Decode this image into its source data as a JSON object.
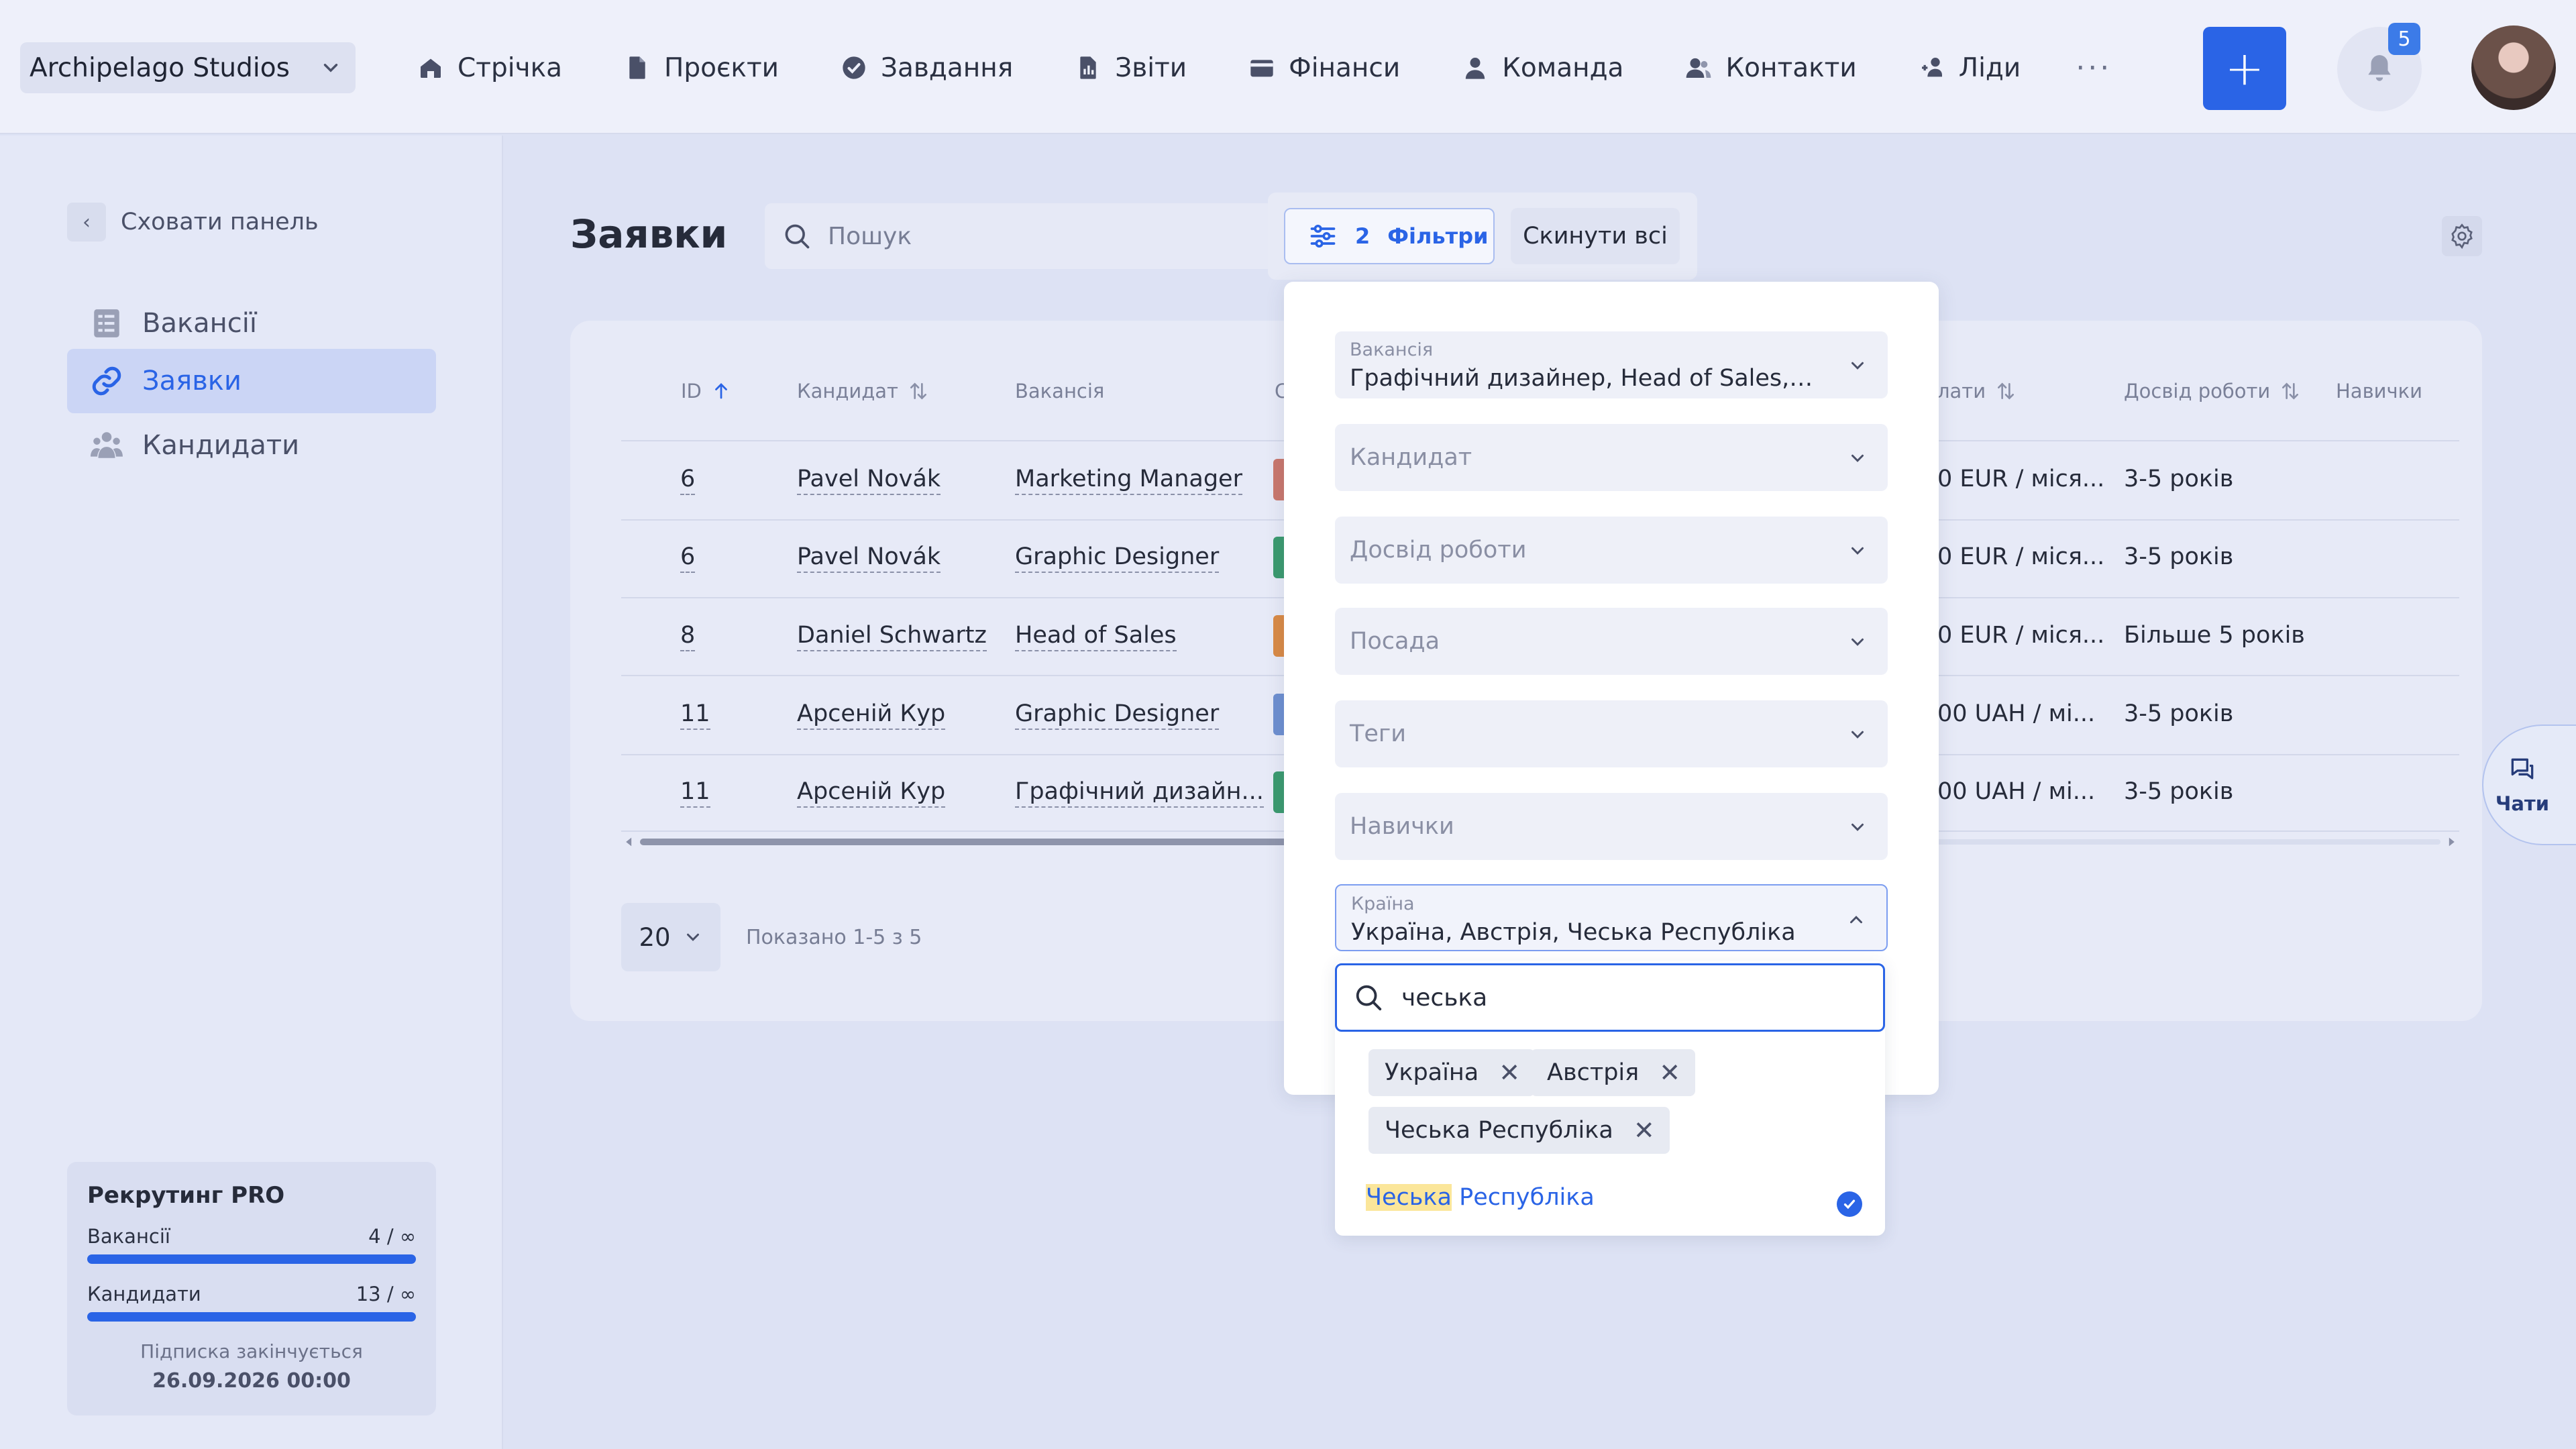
{
  "workspace": {
    "name": "Archipelago Studios"
  },
  "nav": [
    {
      "label": "Стрічка",
      "icon": "home-icon"
    },
    {
      "label": "Проєкти",
      "icon": "document-icon"
    },
    {
      "label": "Завдання",
      "icon": "check-circle-icon"
    },
    {
      "label": "Звіти",
      "icon": "report-icon"
    },
    {
      "label": "Фінанси",
      "icon": "wallet-icon"
    },
    {
      "label": "Команда",
      "icon": "person-icon"
    },
    {
      "label": "Контакти",
      "icon": "contacts-icon"
    },
    {
      "label": "Ліди",
      "icon": "leads-icon"
    }
  ],
  "nav_more": "···",
  "notifications": {
    "count": "5"
  },
  "sidebar": {
    "hide_label": "Сховати панель",
    "items": [
      {
        "label": "Вакансії",
        "icon": "list-icon",
        "active": false
      },
      {
        "label": "Заявки",
        "icon": "link-icon",
        "active": true
      },
      {
        "label": "Кандидати",
        "icon": "people-icon",
        "active": false
      }
    ],
    "plan": {
      "title": "Рекрутинг PRO",
      "rows": [
        {
          "label": "Вакансії",
          "value": "4 / ∞"
        },
        {
          "label": "Кандидати",
          "value": "13 / ∞"
        }
      ],
      "footer": "Підписка закінчується",
      "date": "26.09.2026 00:00"
    }
  },
  "page": {
    "title": "Заявки",
    "search_placeholder": "Пошук",
    "filters_count": "2",
    "filters_label": "Фільтри",
    "reset_label": "Скинути всі"
  },
  "table": {
    "columns": {
      "id": "ID",
      "candidate": "Кандидат",
      "vacancy": "Вакансія",
      "status_partial": "С",
      "salary_partial": "лати",
      "experience": "Досвід роботи",
      "skills": "Навички"
    },
    "rows": [
      {
        "id": "6",
        "candidate": "Pavel Novák",
        "vacancy": "Marketing Manager",
        "status_color": "#c9776d",
        "salary": "0 EUR / міся...",
        "experience": "3-5 років"
      },
      {
        "id": "6",
        "candidate": "Pavel Novák",
        "vacancy": "Graphic Designer",
        "status_color": "#3b9a6f",
        "salary": "0 EUR / міся...",
        "experience": "3-5 років"
      },
      {
        "id": "8",
        "candidate": "Daniel Schwartz",
        "vacancy": "Head of Sales",
        "status_color": "#d98a46",
        "salary": "0 EUR / міся...",
        "experience": "Більше 5 років"
      },
      {
        "id": "11",
        "candidate": "Арсеній Кур",
        "vacancy": "Graphic Designer",
        "status_color": "#6e8fd0",
        "salary": "00 UAH / мі...",
        "experience": "3-5 років"
      },
      {
        "id": "11",
        "candidate": "Арсеній Кур",
        "vacancy": "Графічний дизайн...",
        "status_color": "#3b9a6f",
        "salary": "00 UAH / мі...",
        "experience": "3-5 років"
      }
    ],
    "per_page": "20",
    "shown": "Показано 1-5 з 5"
  },
  "chats_label": "Чати",
  "filter_panel": {
    "vacancy": {
      "label": "Вакансія",
      "value": "Графічний дизайнер, Head of Sales, Grap..."
    },
    "candidate": {
      "placeholder": "Кандидат"
    },
    "experience": {
      "placeholder": "Досвід роботи"
    },
    "position": {
      "placeholder": "Посада"
    },
    "tags": {
      "placeholder": "Теги"
    },
    "skills": {
      "placeholder": "Навички"
    },
    "country": {
      "label": "Країна",
      "value": "Україна, Австрія, Чеська Республіка"
    },
    "country_search": "чеська",
    "selected_tags": [
      "Україна",
      "Австрія",
      "Чеська Республіка"
    ],
    "option_highlight": "Чеська",
    "option_rest": " Республіка"
  },
  "colors": {
    "accent": "#2a64e6",
    "background": "#dde2f4"
  }
}
